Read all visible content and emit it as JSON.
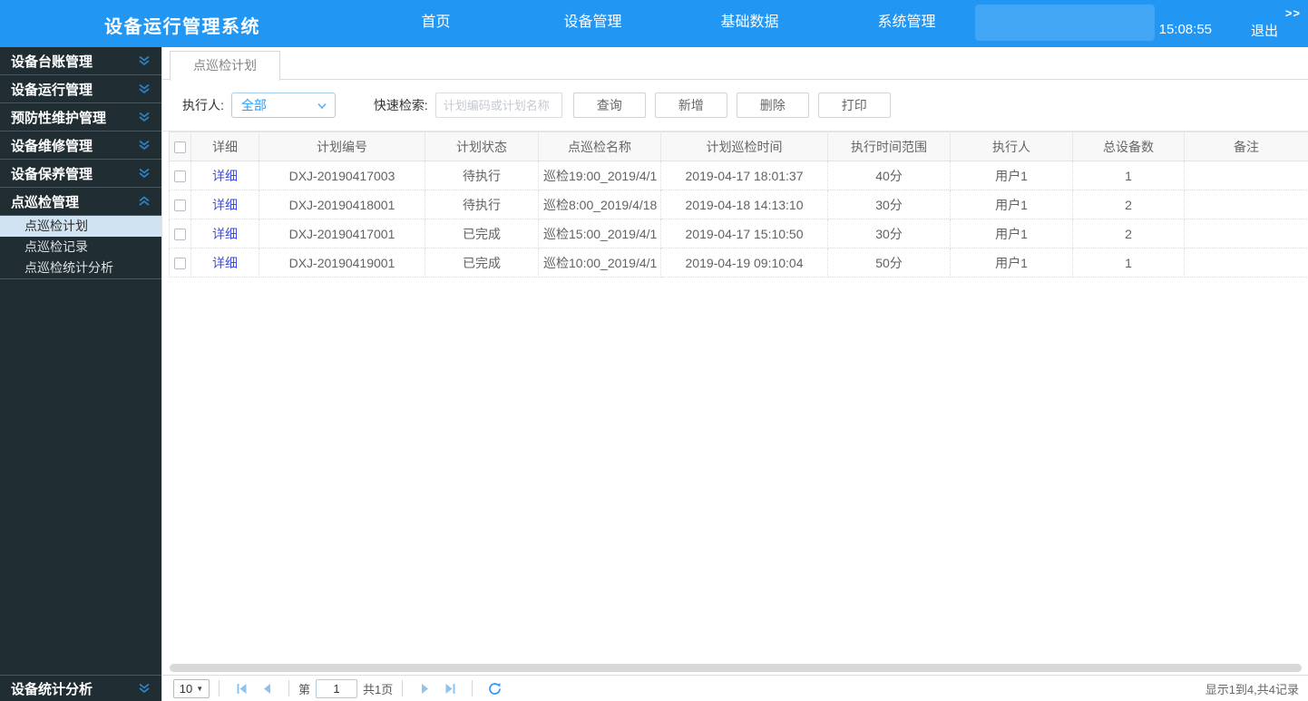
{
  "header": {
    "title": "设备运行管理系统",
    "nav": [
      "首页",
      "设备管理",
      "基础数据",
      "系统管理"
    ],
    "time": "15:08:55",
    "logout_label": "退出",
    "collapse_label": ">>"
  },
  "colors": {
    "header_blue": "#2196f3",
    "sidebar_dark": "#202d33",
    "accent_blue": "#1e9fff",
    "link_blue": "#3d4aec",
    "selected_submenu_bg": "#cfe3f2"
  },
  "sidebar": {
    "groups": [
      "设备台账管理",
      "设备运行管理",
      "预防性维护管理",
      "设备维修管理",
      "设备保养管理",
      "点巡检管理"
    ],
    "expanded_group": "点巡检管理",
    "submenu": [
      "点巡检计划",
      "点巡检记录",
      "点巡检统计分析"
    ],
    "selected_submenu": "点巡检计划",
    "bottom_group": "设备统计分析"
  },
  "tab": {
    "label": "点巡检计划"
  },
  "filter": {
    "executor_label": "执行人:",
    "executor_value": "全部",
    "search_label": "快速检索:",
    "search_placeholder": "计划编码或计划名称",
    "query_button": "查询",
    "add_button": "新增",
    "delete_button": "删除",
    "print_button": "打印"
  },
  "table": {
    "columns": [
      "详细",
      "计划编号",
      "计划状态",
      "点巡检名称",
      "计划巡检时间",
      "执行时间范围",
      "执行人",
      "总设备数",
      "备注"
    ],
    "rows": [
      {
        "detail": "详细",
        "plan_no": "DXJ-20190417003",
        "status": "待执行",
        "name": "巡检19:00_2019/4/1",
        "time": "2019-04-17 18:01:37",
        "range": "40分",
        "executor": "用户1",
        "count": "1",
        "remark": ""
      },
      {
        "detail": "详细",
        "plan_no": "DXJ-20190418001",
        "status": "待执行",
        "name": "巡检8:00_2019/4/18",
        "time": "2019-04-18 14:13:10",
        "range": "30分",
        "executor": "用户1",
        "count": "2",
        "remark": ""
      },
      {
        "detail": "详细",
        "plan_no": "DXJ-20190417001",
        "status": "已完成",
        "name": "巡检15:00_2019/4/1",
        "time": "2019-04-17 15:10:50",
        "range": "30分",
        "executor": "用户1",
        "count": "2",
        "remark": ""
      },
      {
        "detail": "详细",
        "plan_no": "DXJ-20190419001",
        "status": "已完成",
        "name": "巡检10:00_2019/4/1",
        "time": "2019-04-19 09:10:04",
        "range": "50分",
        "executor": "用户1",
        "count": "1",
        "remark": ""
      }
    ]
  },
  "pagination": {
    "page_size": "10",
    "page_prefix": "第",
    "current_page": "1",
    "total_pages": "共1页",
    "summary": "显示1到4,共4记录"
  }
}
